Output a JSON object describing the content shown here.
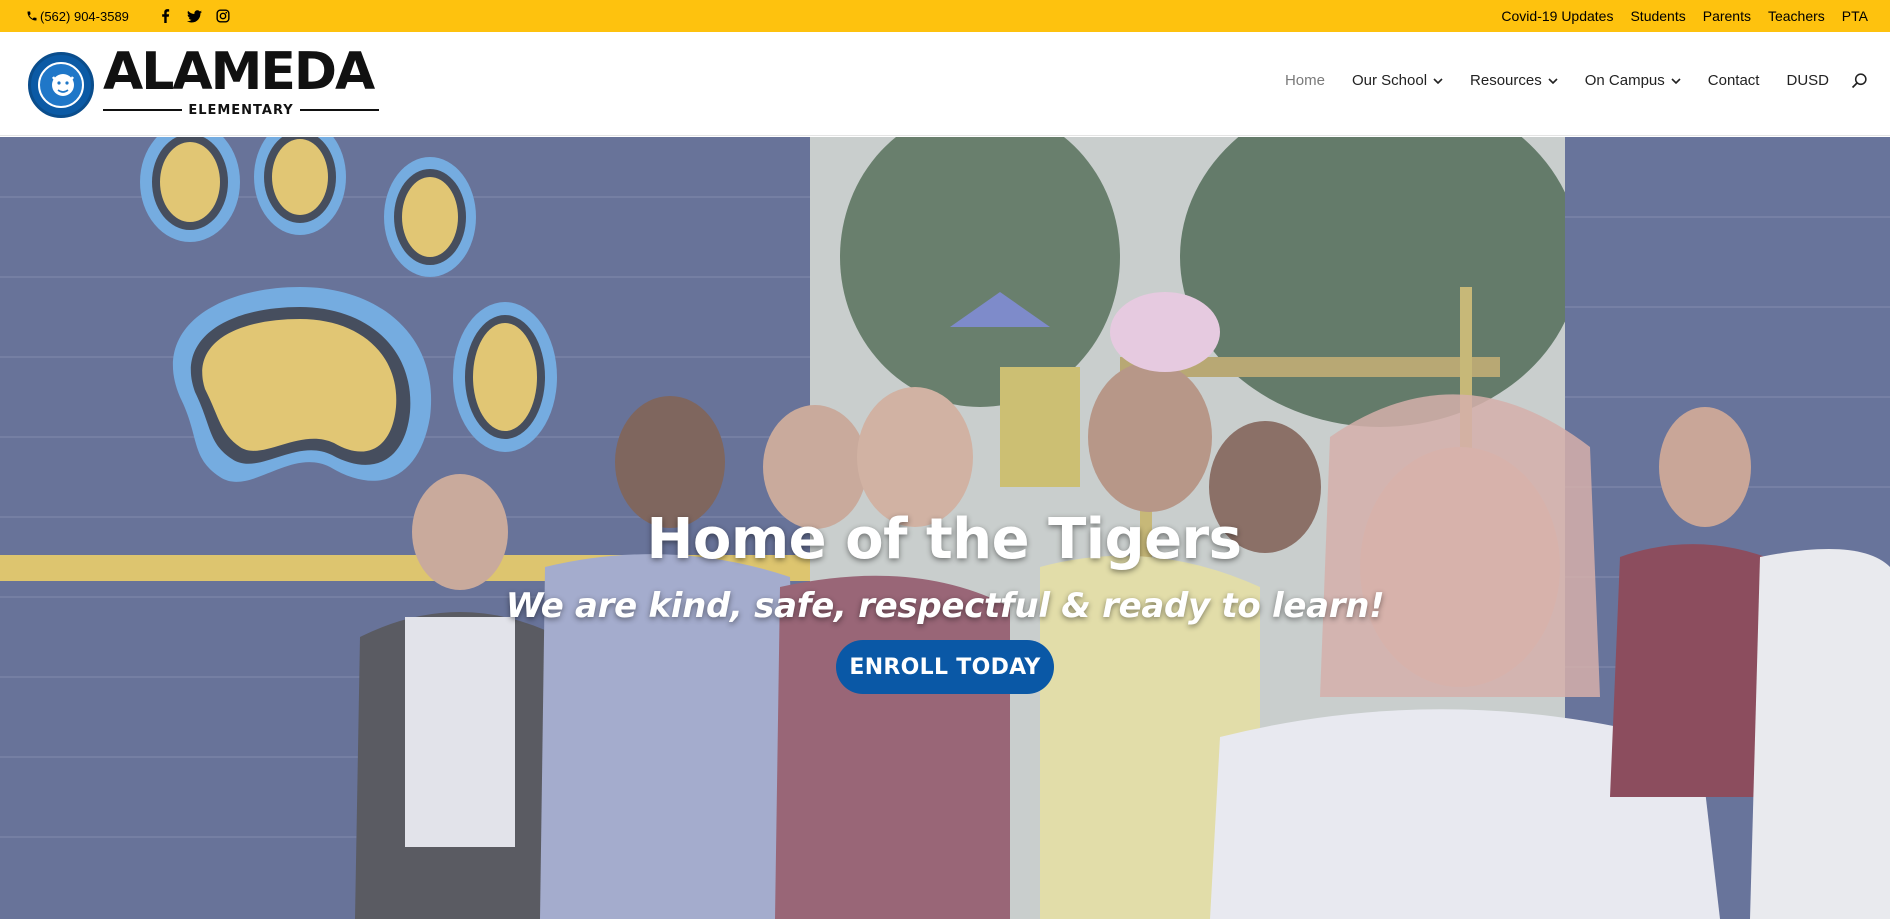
{
  "topbar": {
    "phone": "(562) 904-3589",
    "social": [
      "facebook-icon",
      "twitter-icon",
      "instagram-icon"
    ],
    "links": [
      "Covid-19 Updates",
      "Students",
      "Parents",
      "Teachers",
      "PTA"
    ],
    "background": "#fec20e"
  },
  "header": {
    "logo_title": "ALAMEDA",
    "logo_subtitle": "ELEMENTARY",
    "nav": [
      {
        "label": "Home",
        "active": true,
        "dropdown": false
      },
      {
        "label": "Our School",
        "active": false,
        "dropdown": true
      },
      {
        "label": "Resources",
        "active": false,
        "dropdown": true
      },
      {
        "label": "On Campus",
        "active": false,
        "dropdown": true
      },
      {
        "label": "Contact",
        "active": false,
        "dropdown": false
      },
      {
        "label": "DUSD",
        "active": false,
        "dropdown": false
      }
    ],
    "search_icon": "search-icon"
  },
  "hero": {
    "title": "Home of the Tigers",
    "subtitle": "We are kind, safe, respectful & ready to learn!",
    "button_label": "ENROLL TODAY",
    "button_color": "#0a58a6"
  }
}
